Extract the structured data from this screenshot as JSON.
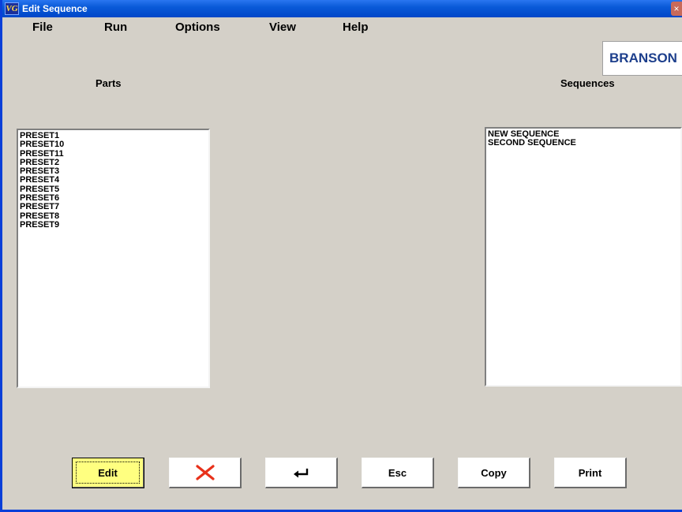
{
  "window": {
    "title": "Edit Sequence",
    "icon_text": "VG",
    "close_glyph": "×"
  },
  "menu": {
    "items": [
      {
        "label": "File"
      },
      {
        "label": "Run"
      },
      {
        "label": "Options"
      },
      {
        "label": "View"
      },
      {
        "label": "Help"
      }
    ]
  },
  "logo": {
    "text": "BRANSON",
    "color": "#1d3f8c"
  },
  "parts": {
    "label": "Parts",
    "items": [
      "PRESET1",
      "PRESET10",
      "PRESET11",
      "PRESET2",
      "PRESET3",
      "PRESET4",
      "PRESET5",
      "PRESET6",
      "PRESET7",
      "PRESET8",
      "PRESET9"
    ]
  },
  "sequences": {
    "label": "Sequences",
    "items": [
      "NEW SEQUENCE",
      "SECOND SEQUENCE"
    ]
  },
  "buttons": {
    "edit": "Edit",
    "delete_icon": "delete-x-icon",
    "delete_color": "#e8311a",
    "enter_icon": "return-arrow-icon",
    "esc": "Esc",
    "copy": "Copy",
    "print": "Print",
    "edit_highlight": "#ffff80"
  }
}
